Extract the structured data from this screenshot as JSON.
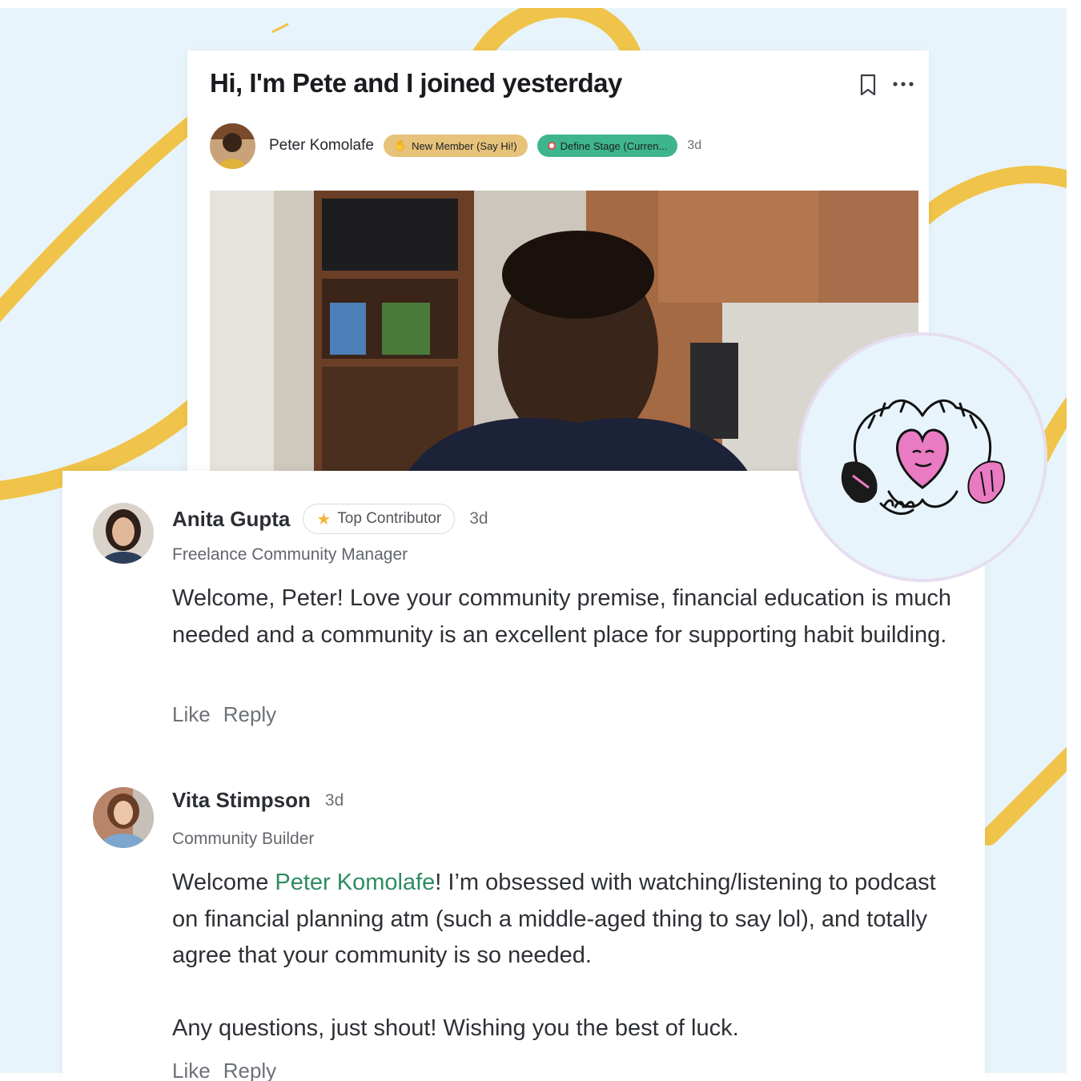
{
  "colors": {
    "background": "#e8f4fb",
    "swoosh": "#f0c44a",
    "badge_new_member": "#e6c27a",
    "badge_stage": "#3fb58e",
    "mention": "#2e8b62",
    "heart": "#e97bc2"
  },
  "post": {
    "title": "Hi, I'm Pete and I joined yesterday",
    "author": "Peter Komolafe",
    "badges": [
      {
        "label": "New Member (Say Hi!)",
        "icon": "wave-icon"
      },
      {
        "label": "Define Stage (Curren...",
        "icon": "target-icon"
      }
    ],
    "time": "3d",
    "icons": {
      "bookmark": "bookmark-icon",
      "more": "more-icon"
    }
  },
  "comments": [
    {
      "name": "Anita Gupta",
      "badge": "Top Contributor",
      "badge_icon": "star-icon",
      "time": "3d",
      "role": "Freelance Community Manager",
      "body": "Welcome, Peter! Love your community premise, financial education is much needed and a community is an excellent place for supporting habit building.",
      "actions": {
        "like": "Like",
        "reply": "Reply"
      }
    },
    {
      "name": "Vita Stimpson",
      "time": "3d",
      "role": "Community Builder",
      "body_prefix": "Welcome ",
      "mention": "Peter Komolafe",
      "body_suffix": "! I’m obsessed with watching/listening to podcast on financial planning atm (such a middle-aged thing to say lol), and totally agree that your community is so needed.",
      "body_second": "Any questions, just shout! Wishing you the best of luck.",
      "actions": {
        "like": "Like",
        "reply": "Reply"
      }
    }
  ],
  "sticker": {
    "icon": "heart-hands-icon"
  }
}
